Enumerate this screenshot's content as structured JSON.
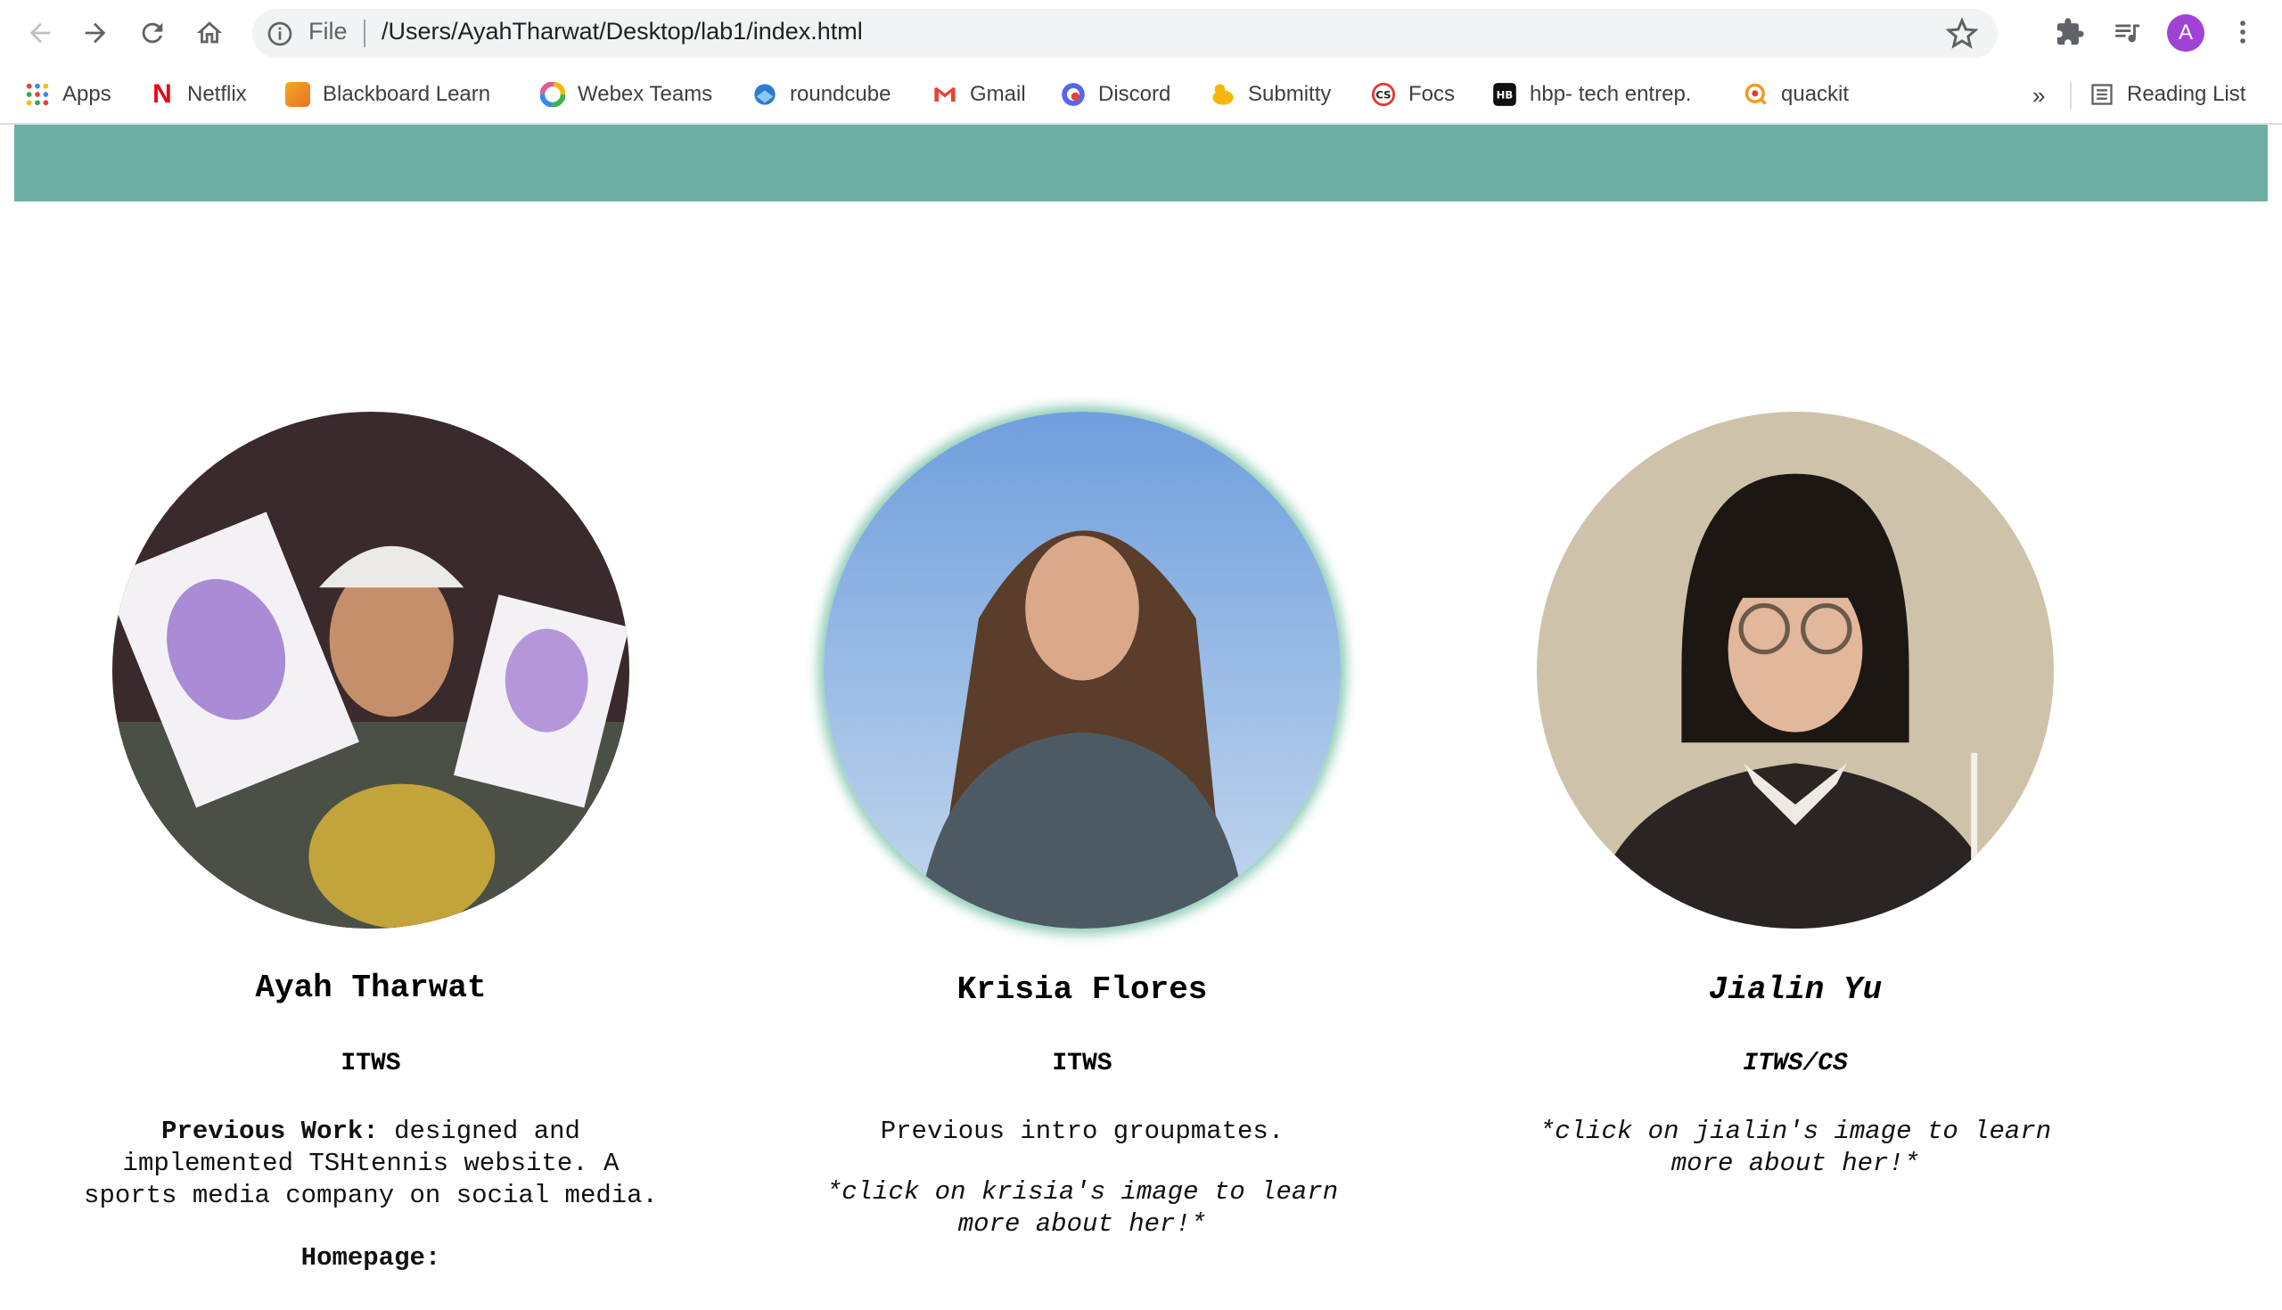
{
  "browser": {
    "file_label": "File",
    "url": "/Users/AyahTharwat/Desktop/lab1/index.html",
    "profile_initial": "A"
  },
  "bookmarks": {
    "items": [
      {
        "label": "Apps",
        "icon": "apps-grid-icon"
      },
      {
        "label": "Netflix",
        "icon": "netflix-icon"
      },
      {
        "label": "Blackboard Learn",
        "icon": "blackboard-icon"
      },
      {
        "label": "Webex Teams",
        "icon": "webex-icon"
      },
      {
        "label": "roundcube",
        "icon": "roundcube-icon"
      },
      {
        "label": "Gmail",
        "icon": "gmail-icon"
      },
      {
        "label": "Discord",
        "icon": "discord-icon"
      },
      {
        "label": "Submitty",
        "icon": "submitty-icon"
      },
      {
        "label": "Focs",
        "icon": "focs-icon"
      },
      {
        "label": "hbp- tech entrep.",
        "icon": "hbp-icon"
      },
      {
        "label": "quackit",
        "icon": "quackit-icon"
      }
    ],
    "more": "»",
    "reading_list": "Reading List"
  },
  "theme": {
    "banner_color": "#6eafa3"
  },
  "members": [
    {
      "name": "Ayah Tharwat",
      "major": "ITWS",
      "work_label": "Previous Work:",
      "work_line1": " designed and",
      "work_line2": "implemented TSHtennis website. A",
      "work_line3": "sports media company on social media.",
      "homepage_label": "Homepage:"
    },
    {
      "name": "Krisia Flores",
      "major": "ITWS",
      "note": "Previous intro groupmates.",
      "click_line1": "*click on krisia's image to learn",
      "click_line2": "more about her!*"
    },
    {
      "name": "Jialin Yu",
      "major": "ITWS/CS",
      "click_line1": "*click on jialin's image to learn",
      "click_line2": "more about her!*"
    }
  ]
}
